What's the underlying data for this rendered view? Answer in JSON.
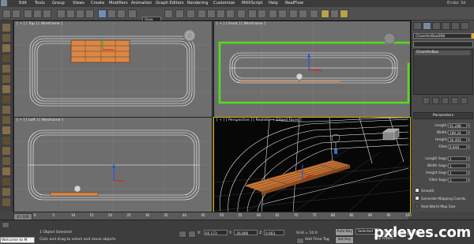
{
  "menu": {
    "items": [
      "Edit",
      "Tools",
      "Group",
      "Views",
      "Create",
      "Modifiers",
      "Animation",
      "Graph Editors",
      "Rendering",
      "Customize",
      "MAXScript",
      "Help",
      "RealFlow"
    ],
    "workspace": "Ender 3d"
  },
  "toolbar": {
    "selection_filter": "View"
  },
  "viewports": {
    "top_label": "[ + ] [ Top ] [ Wireframe ]",
    "front_label": "[ + ] [ Front ] [ Wireframe ]",
    "left_label": "[ + ] [ Left ] [ Wireframe ]",
    "perspective_label": "[ + ] [ Perspective ] [ Realistic + Edged Faces ]"
  },
  "command_panel": {
    "object_name": "ChamferBox068",
    "object_color": "#e9a92f",
    "stack_item": "ChamferBox",
    "parameters_title": "Parameters",
    "params": [
      {
        "label": "Length:",
        "value": "91.288"
      },
      {
        "label": "Width:",
        "value": "186.24"
      },
      {
        "label": "Height:",
        "value": "36.493"
      },
      {
        "label": "Fillet:",
        "value": "8.848"
      },
      {
        "label": "Length Segs:",
        "value": "1"
      },
      {
        "label": "Width Segs:",
        "value": "1"
      },
      {
        "label": "Height Segs:",
        "value": "1"
      },
      {
        "label": "Fillet Segs:",
        "value": "3"
      }
    ],
    "smooth_label": "Smooth",
    "mapping_label": "Generate Mapping Coords.",
    "real_world_label": "Real-World Map Size"
  },
  "timeline": {
    "slider_label": "0 / 100",
    "ticks": [
      "0",
      "5",
      "10",
      "15",
      "20",
      "25",
      "30",
      "35",
      "40",
      "45",
      "50",
      "55",
      "60",
      "65",
      "70",
      "75",
      "80",
      "85",
      "90",
      "95",
      "100"
    ]
  },
  "status": {
    "welcome": "Welcome to M",
    "selection": "1 Object Selected",
    "hint": "Click and drag to select and move objects",
    "x_label": "X:",
    "x_value": "65.173",
    "y_label": "Y:",
    "y_value": "-26.806",
    "z_label": "Z:",
    "z_value": "0.003",
    "grid": "Grid = 10.0",
    "add_time_tag": "Add Time Tag",
    "auto_key": "Auto Key",
    "key_filter_value": "Selected",
    "set_key": "Set Key",
    "key_filters": "Key Filters..."
  },
  "colors": {
    "highlight": "#55dd1a",
    "wire": "#ffffff",
    "wood": "#d9884a",
    "active_viewport": "#d8b000",
    "gizmo_x": "#d81e1e",
    "gizmo_y": "#22b422",
    "gizmo_z": "#2457d6"
  },
  "watermark": "pxleyes.com"
}
